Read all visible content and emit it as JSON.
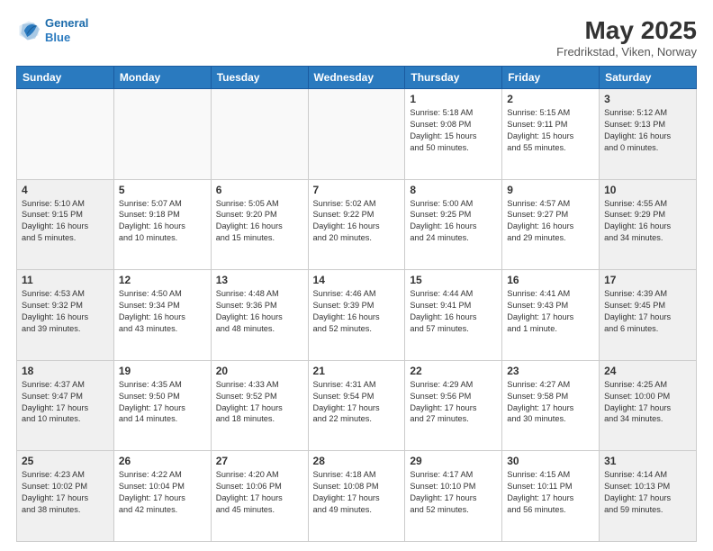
{
  "header": {
    "logo_line1": "General",
    "logo_line2": "Blue",
    "title": "May 2025",
    "location": "Fredrikstad, Viken, Norway"
  },
  "weekdays": [
    "Sunday",
    "Monday",
    "Tuesday",
    "Wednesday",
    "Thursday",
    "Friday",
    "Saturday"
  ],
  "weeks": [
    [
      {
        "day": "",
        "info": "",
        "empty": true
      },
      {
        "day": "",
        "info": "",
        "empty": true
      },
      {
        "day": "",
        "info": "",
        "empty": true
      },
      {
        "day": "",
        "info": "",
        "empty": true
      },
      {
        "day": "1",
        "info": "Sunrise: 5:18 AM\nSunset: 9:08 PM\nDaylight: 15 hours\nand 50 minutes."
      },
      {
        "day": "2",
        "info": "Sunrise: 5:15 AM\nSunset: 9:11 PM\nDaylight: 15 hours\nand 55 minutes."
      },
      {
        "day": "3",
        "info": "Sunrise: 5:12 AM\nSunset: 9:13 PM\nDaylight: 16 hours\nand 0 minutes."
      }
    ],
    [
      {
        "day": "4",
        "info": "Sunrise: 5:10 AM\nSunset: 9:15 PM\nDaylight: 16 hours\nand 5 minutes."
      },
      {
        "day": "5",
        "info": "Sunrise: 5:07 AM\nSunset: 9:18 PM\nDaylight: 16 hours\nand 10 minutes."
      },
      {
        "day": "6",
        "info": "Sunrise: 5:05 AM\nSunset: 9:20 PM\nDaylight: 16 hours\nand 15 minutes."
      },
      {
        "day": "7",
        "info": "Sunrise: 5:02 AM\nSunset: 9:22 PM\nDaylight: 16 hours\nand 20 minutes."
      },
      {
        "day": "8",
        "info": "Sunrise: 5:00 AM\nSunset: 9:25 PM\nDaylight: 16 hours\nand 24 minutes."
      },
      {
        "day": "9",
        "info": "Sunrise: 4:57 AM\nSunset: 9:27 PM\nDaylight: 16 hours\nand 29 minutes."
      },
      {
        "day": "10",
        "info": "Sunrise: 4:55 AM\nSunset: 9:29 PM\nDaylight: 16 hours\nand 34 minutes."
      }
    ],
    [
      {
        "day": "11",
        "info": "Sunrise: 4:53 AM\nSunset: 9:32 PM\nDaylight: 16 hours\nand 39 minutes."
      },
      {
        "day": "12",
        "info": "Sunrise: 4:50 AM\nSunset: 9:34 PM\nDaylight: 16 hours\nand 43 minutes."
      },
      {
        "day": "13",
        "info": "Sunrise: 4:48 AM\nSunset: 9:36 PM\nDaylight: 16 hours\nand 48 minutes."
      },
      {
        "day": "14",
        "info": "Sunrise: 4:46 AM\nSunset: 9:39 PM\nDaylight: 16 hours\nand 52 minutes."
      },
      {
        "day": "15",
        "info": "Sunrise: 4:44 AM\nSunset: 9:41 PM\nDaylight: 16 hours\nand 57 minutes."
      },
      {
        "day": "16",
        "info": "Sunrise: 4:41 AM\nSunset: 9:43 PM\nDaylight: 17 hours\nand 1 minute."
      },
      {
        "day": "17",
        "info": "Sunrise: 4:39 AM\nSunset: 9:45 PM\nDaylight: 17 hours\nand 6 minutes."
      }
    ],
    [
      {
        "day": "18",
        "info": "Sunrise: 4:37 AM\nSunset: 9:47 PM\nDaylight: 17 hours\nand 10 minutes."
      },
      {
        "day": "19",
        "info": "Sunrise: 4:35 AM\nSunset: 9:50 PM\nDaylight: 17 hours\nand 14 minutes."
      },
      {
        "day": "20",
        "info": "Sunrise: 4:33 AM\nSunset: 9:52 PM\nDaylight: 17 hours\nand 18 minutes."
      },
      {
        "day": "21",
        "info": "Sunrise: 4:31 AM\nSunset: 9:54 PM\nDaylight: 17 hours\nand 22 minutes."
      },
      {
        "day": "22",
        "info": "Sunrise: 4:29 AM\nSunset: 9:56 PM\nDaylight: 17 hours\nand 27 minutes."
      },
      {
        "day": "23",
        "info": "Sunrise: 4:27 AM\nSunset: 9:58 PM\nDaylight: 17 hours\nand 30 minutes."
      },
      {
        "day": "24",
        "info": "Sunrise: 4:25 AM\nSunset: 10:00 PM\nDaylight: 17 hours\nand 34 minutes."
      }
    ],
    [
      {
        "day": "25",
        "info": "Sunrise: 4:23 AM\nSunset: 10:02 PM\nDaylight: 17 hours\nand 38 minutes."
      },
      {
        "day": "26",
        "info": "Sunrise: 4:22 AM\nSunset: 10:04 PM\nDaylight: 17 hours\nand 42 minutes."
      },
      {
        "day": "27",
        "info": "Sunrise: 4:20 AM\nSunset: 10:06 PM\nDaylight: 17 hours\nand 45 minutes."
      },
      {
        "day": "28",
        "info": "Sunrise: 4:18 AM\nSunset: 10:08 PM\nDaylight: 17 hours\nand 49 minutes."
      },
      {
        "day": "29",
        "info": "Sunrise: 4:17 AM\nSunset: 10:10 PM\nDaylight: 17 hours\nand 52 minutes."
      },
      {
        "day": "30",
        "info": "Sunrise: 4:15 AM\nSunset: 10:11 PM\nDaylight: 17 hours\nand 56 minutes."
      },
      {
        "day": "31",
        "info": "Sunrise: 4:14 AM\nSunset: 10:13 PM\nDaylight: 17 hours\nand 59 minutes."
      }
    ]
  ]
}
